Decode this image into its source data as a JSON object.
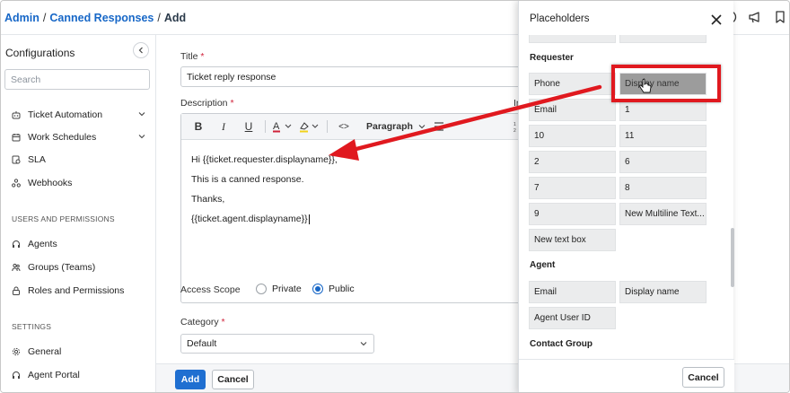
{
  "breadcrumb": {
    "root": "Admin",
    "parent": "Canned Responses",
    "current": "Add",
    "sep": "/"
  },
  "sidebar": {
    "title": "Configurations",
    "search_placeholder": "Search",
    "items": [
      {
        "label": "Ticket Automation",
        "icon": "robot-icon",
        "expandable": true
      },
      {
        "label": "Work Schedules",
        "icon": "calendar-icon",
        "expandable": true
      },
      {
        "label": "SLA",
        "icon": "sla-icon",
        "expandable": false
      },
      {
        "label": "Webhooks",
        "icon": "webhook-icon",
        "expandable": false
      }
    ],
    "section_users": "USERS AND PERMISSIONS",
    "user_items": [
      {
        "label": "Agents",
        "icon": "headset-icon"
      },
      {
        "label": "Groups (Teams)",
        "icon": "group-icon"
      },
      {
        "label": "Roles and Permissions",
        "icon": "lock-icon"
      }
    ],
    "section_settings": "SETTINGS",
    "settings_items": [
      {
        "label": "General",
        "icon": "gear-icon"
      },
      {
        "label": "Agent Portal",
        "icon": "headset-icon"
      }
    ]
  },
  "form": {
    "title_label": "Title",
    "required_mark": "*",
    "title_value": "Ticket reply response",
    "description_label": "Description",
    "toolbar": {
      "bold": "B",
      "italic": "I",
      "underline": "U",
      "code": "<>",
      "block_format": "Paragraph"
    },
    "cut_off_label": "Ir",
    "body_lines": [
      "Hi {{ticket.requester.displayname}},",
      "This is a canned response.",
      "Thanks,",
      "{{ticket.agent.displayname}}"
    ],
    "access_scope_label": "Access Scope",
    "access_options": [
      {
        "label": "Private",
        "selected": false
      },
      {
        "label": "Public",
        "selected": true
      }
    ],
    "category_label": "Category",
    "category_value": "Default",
    "add_button": "Add",
    "cancel_button": "Cancel"
  },
  "placeholders_panel": {
    "title": "Placeholders",
    "sections": [
      {
        "name": "Requester",
        "items": [
          "Phone",
          "Display name",
          "Email",
          "1",
          "10",
          "11",
          "2",
          "6",
          "7",
          "8",
          "9",
          "New Multiline Text...",
          "New text box"
        ]
      },
      {
        "name": "Agent",
        "items": [
          "Email",
          "Display name",
          "Agent User ID"
        ]
      },
      {
        "name": "Contact Group",
        "items": []
      }
    ],
    "highlighted_item": "Display name",
    "cancel_button": "Cancel"
  },
  "colors": {
    "accent": "#1767c7",
    "primary_button": "#1f6fd1",
    "annotation_red": "#e0191f",
    "highlighted_cell": "#9c9c9c"
  }
}
